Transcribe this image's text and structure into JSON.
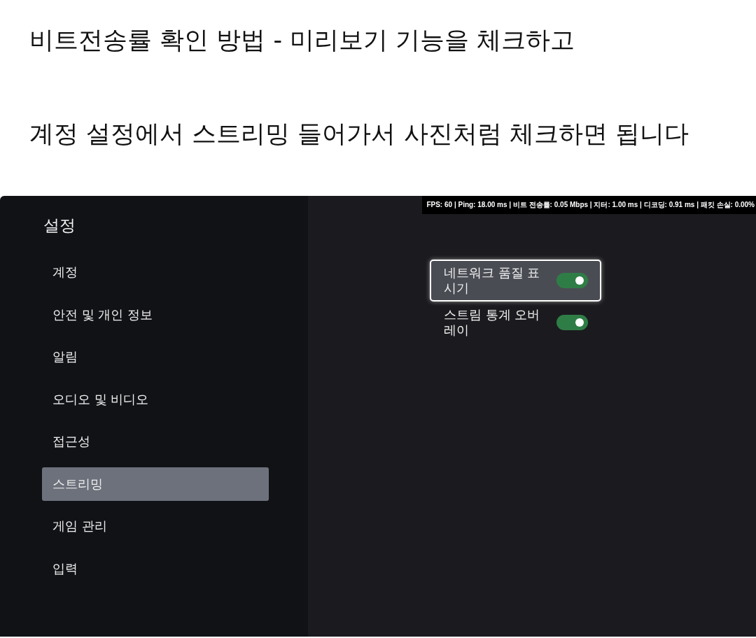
{
  "captions": [
    "비트전송률 확인 방법 - 미리보기 기능을 체크하고",
    "계정 설정에서 스트리밍 들어가서 사진처럼 체크하면 됩니다"
  ],
  "settings": {
    "title": "설정",
    "sidebar": {
      "items": [
        {
          "label": "계정",
          "selected": false
        },
        {
          "label": "안전 및 개인 정보",
          "selected": false
        },
        {
          "label": "알림",
          "selected": false
        },
        {
          "label": "오디오 및 비디오",
          "selected": false
        },
        {
          "label": "접근성",
          "selected": false
        },
        {
          "label": "스트리밍",
          "selected": true
        },
        {
          "label": "게임 관리",
          "selected": false
        },
        {
          "label": "입력",
          "selected": false
        }
      ]
    },
    "stats_overlay": "FPS: 60 | Ping: 18.00 ms | 비트 전송률: 0.05 Mbps | 지터: 1.00 ms | 디코딩: 0.91 ms | 패킷 손실: 0.00%",
    "toggles": [
      {
        "label": "네트워크 품질 표시기",
        "on": true,
        "focused": true
      },
      {
        "label": "스트림 통계 오버레이",
        "on": true,
        "focused": false
      }
    ]
  }
}
